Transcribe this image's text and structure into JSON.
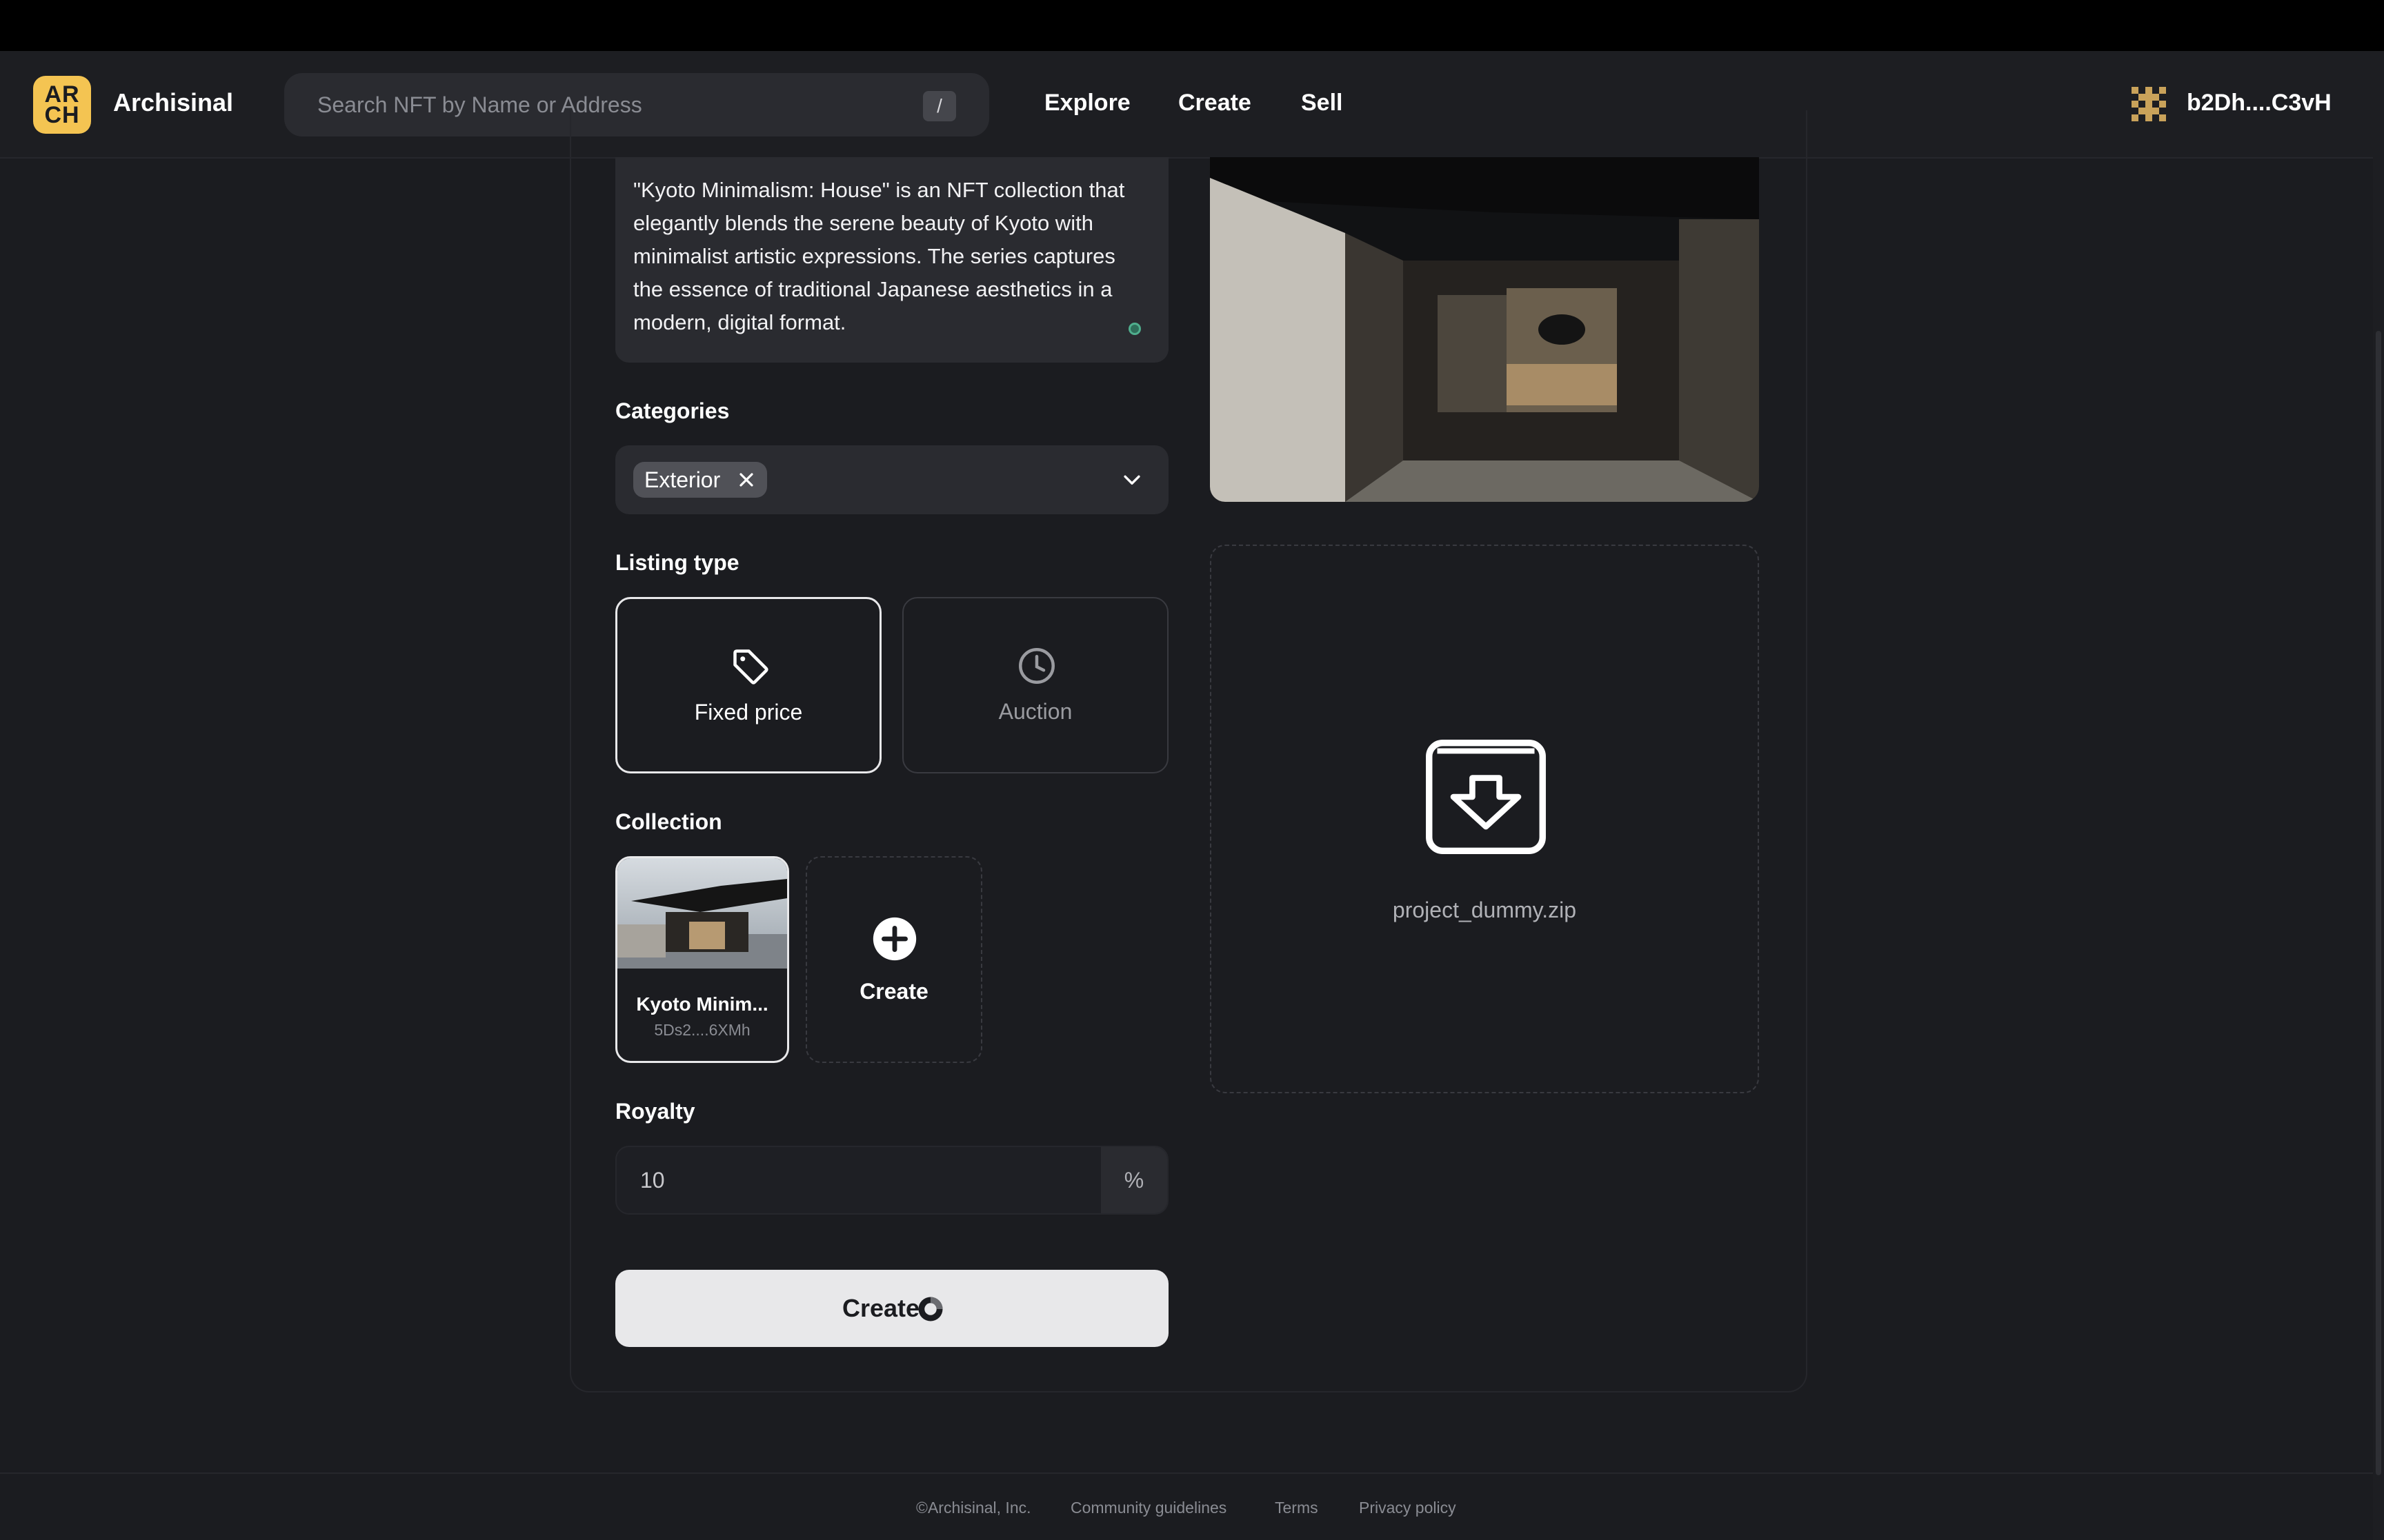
{
  "app": {
    "name": "Archisinal",
    "logo_text": "AR\nCH"
  },
  "search": {
    "placeholder": "Search NFT by Name or Address",
    "shortcut": "/"
  },
  "nav": [
    {
      "label": "Explore"
    },
    {
      "label": "Create"
    },
    {
      "label": "Sell"
    }
  ],
  "account": {
    "wallet": "b2Dh....C3vH",
    "avatar_icon": "identicon-icon"
  },
  "form": {
    "description": "\"Kyoto Minimalism: House\" is an NFT collection that elegantly blends the serene beauty of Kyoto with minimalist artistic expressions. The series captures the essence of traditional Japanese aesthetics in a modern, digital format.",
    "categories_label": "Categories",
    "selected_category": "Exterior",
    "listing_type_label": "Listing type",
    "listing_types": [
      {
        "label": "Fixed price",
        "icon": "tag-icon",
        "selected": true
      },
      {
        "label": "Auction",
        "icon": "clock-icon",
        "selected": false
      }
    ],
    "collection_label": "Collection",
    "collection": {
      "name": "Kyoto Minim...",
      "address": "5Ds2....6XMh"
    },
    "create_collection_label": "Create",
    "royalty_label": "Royalty",
    "royalty_value": "10",
    "royalty_unit": "%",
    "submit_label": "Create"
  },
  "upload": {
    "file_name": "project_dummy.zip",
    "icon": "archive-download-icon"
  },
  "footer": {
    "copyright": "©Archisinal, Inc.",
    "links": [
      "Community guidelines",
      "Terms",
      "Privacy policy"
    ]
  },
  "colors": {
    "accent": "#f4c452",
    "background": "#1b1c20",
    "surface": "#2a2b30",
    "button": "#e8e8ea"
  }
}
